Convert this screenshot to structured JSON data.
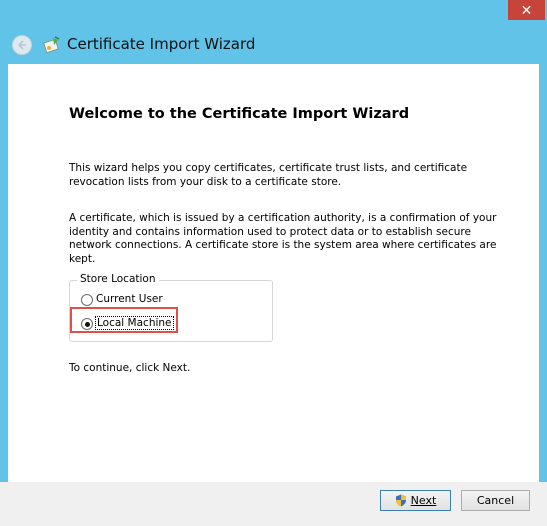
{
  "window": {
    "title": "Certificate Import Wizard",
    "close_glyph": "✕",
    "accent_color": "#61c3e8",
    "close_color": "#c7443a"
  },
  "main": {
    "heading": "Welcome to the Certificate Import Wizard",
    "paragraph1": "This wizard helps you copy certificates, certificate trust lists, and certificate revocation lists from your disk to a certificate store.",
    "paragraph2": "A certificate, which is issued by a certification authority, is a confirmation of your identity and contains information used to protect data or to establish secure network connections. A certificate store is the system area where certificates are kept.",
    "store_location": {
      "legend": "Store Location",
      "options": [
        {
          "label": "Current User",
          "selected": false
        },
        {
          "label": "Local Machine",
          "selected": true
        }
      ]
    },
    "continue_text": "To continue, click Next."
  },
  "footer": {
    "next_label": "Next",
    "cancel_label": "Cancel"
  },
  "icons": {
    "back": "back-arrow-icon",
    "wizard": "certificate-wizard-icon",
    "shield": "uac-shield-icon"
  }
}
